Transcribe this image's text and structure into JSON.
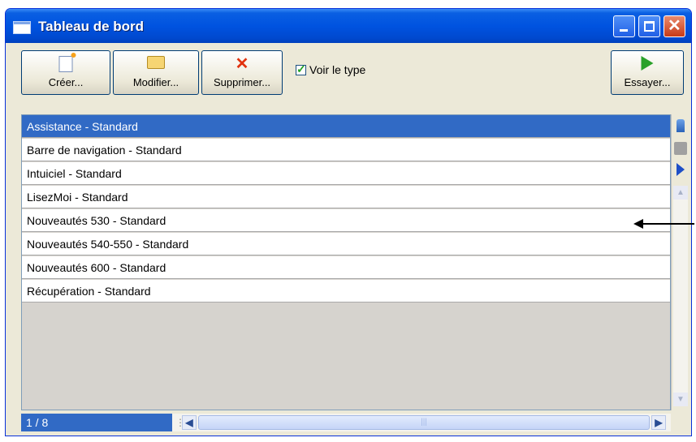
{
  "window": {
    "title": "Tableau de bord"
  },
  "toolbar": {
    "create_label": "Créer...",
    "modify_label": "Modifier...",
    "delete_label": "Supprimer...",
    "try_label": "Essayer...",
    "show_type_label": "Voir le type",
    "show_type_checked": true
  },
  "list": {
    "items": [
      {
        "label": "Assistance - Standard",
        "selected": true
      },
      {
        "label": "Barre de navigation - Standard"
      },
      {
        "label": "Intuiciel - Standard"
      },
      {
        "label": "LisezMoi - Standard"
      },
      {
        "label": "Nouveautés 530 - Standard"
      },
      {
        "label": "Nouveautés 540-550 - Standard"
      },
      {
        "label": "Nouveautés 600 - Standard"
      },
      {
        "label": "Récupération - Standard"
      }
    ]
  },
  "status": {
    "counter": "1 / 8"
  },
  "colors": {
    "title_bar": "#0053e0",
    "selection": "#316ac5",
    "window_bg": "#ece9d8"
  }
}
